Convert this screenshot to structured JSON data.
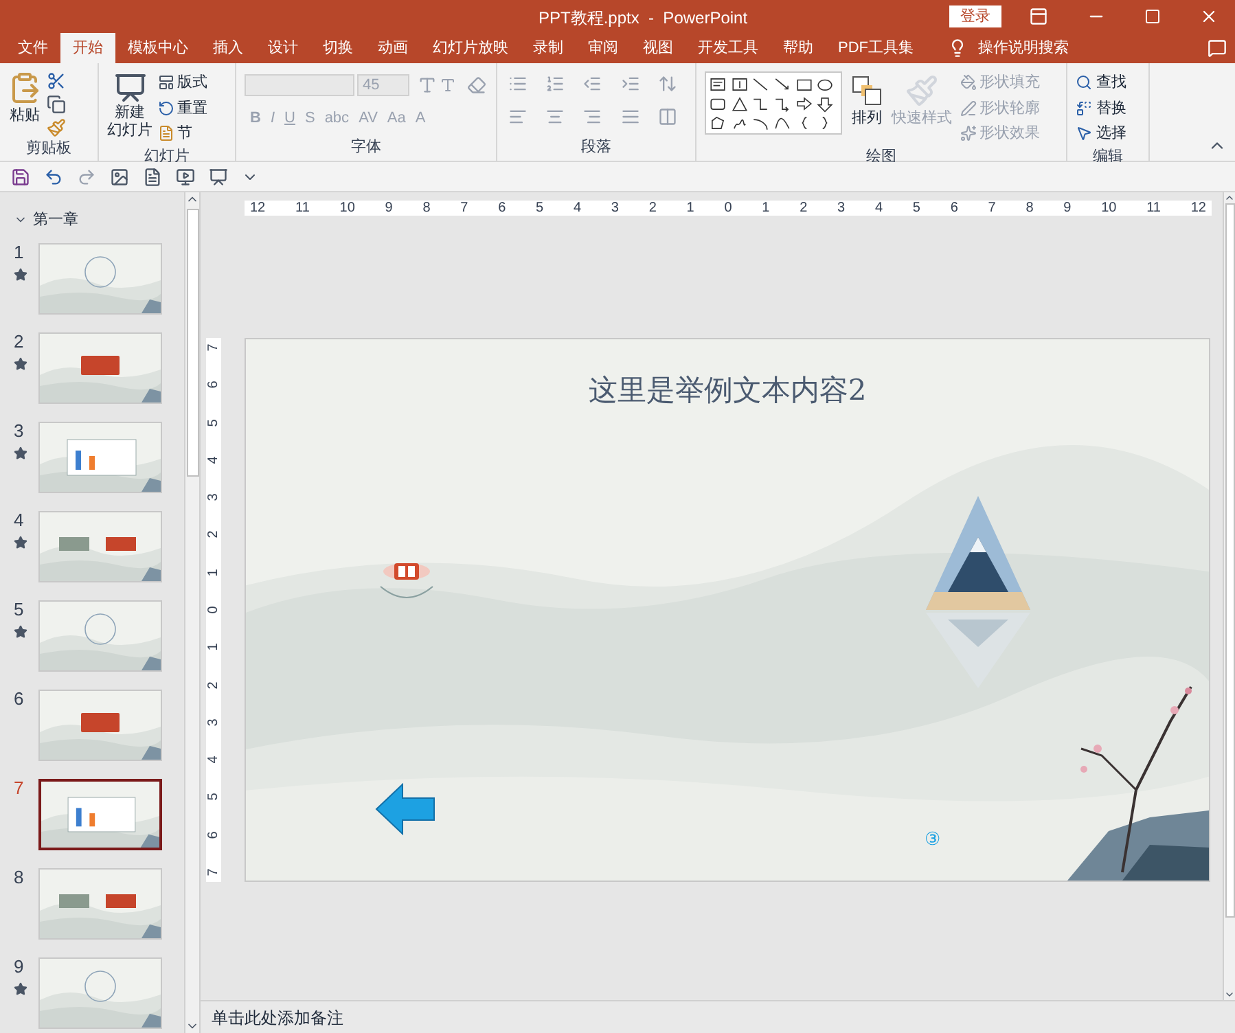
{
  "window": {
    "title": "PPT教程.pptx  -  PowerPoint",
    "sign_in": "登录"
  },
  "tabs": [
    {
      "label": "文件",
      "selected": false
    },
    {
      "label": "开始",
      "selected": true
    },
    {
      "label": "模板中心",
      "selected": false
    },
    {
      "label": "插入",
      "selected": false
    },
    {
      "label": "设计",
      "selected": false
    },
    {
      "label": "切换",
      "selected": false
    },
    {
      "label": "动画",
      "selected": false
    },
    {
      "label": "幻灯片放映",
      "selected": false
    },
    {
      "label": "录制",
      "selected": false
    },
    {
      "label": "审阅",
      "selected": false
    },
    {
      "label": "视图",
      "selected": false
    },
    {
      "label": "开发工具",
      "selected": false
    },
    {
      "label": "帮助",
      "selected": false
    },
    {
      "label": "PDF工具集",
      "selected": false
    }
  ],
  "tell_me": "操作说明搜索",
  "ribbon": {
    "clipboard": {
      "paste": "粘贴",
      "label": "剪贴板"
    },
    "slides": {
      "new_slide": [
        "新建",
        "幻灯片"
      ],
      "layout": "版式",
      "reset": "重置",
      "section": "节",
      "label": "幻灯片"
    },
    "font": {
      "font_size": "45",
      "disabled": true,
      "buttons": [
        "B",
        "I",
        "U",
        "S",
        "abc",
        "AV",
        "Aa",
        "A"
      ],
      "label": "字体"
    },
    "paragraph": {
      "label": "段落"
    },
    "drawing": {
      "arrange": "排列",
      "quick_styles": {
        "label": "快速样式",
        "disabled": true
      },
      "format": [
        {
          "label": "形状填充",
          "disabled": true
        },
        {
          "label": "形状轮廓",
          "disabled": true
        },
        {
          "label": "形状效果",
          "disabled": true
        }
      ],
      "label": "绘图"
    },
    "editing": {
      "items": [
        {
          "label": "查找"
        },
        {
          "label": "替换"
        },
        {
          "label": "选择"
        }
      ],
      "label": "编辑"
    }
  },
  "outline": {
    "section": "第一章",
    "slides": [
      {
        "number": "1",
        "star": true,
        "selected": false
      },
      {
        "number": "2",
        "star": true,
        "selected": false
      },
      {
        "number": "3",
        "star": true,
        "selected": false
      },
      {
        "number": "4",
        "star": true,
        "selected": false
      },
      {
        "number": "5",
        "star": true,
        "selected": false
      },
      {
        "number": "6",
        "star": false,
        "selected": false
      },
      {
        "number": "7",
        "star": false,
        "selected": true
      },
      {
        "number": "8",
        "star": false,
        "selected": false
      },
      {
        "number": "9",
        "star": true,
        "selected": false
      }
    ]
  },
  "ruler": {
    "horizontal": [
      "12",
      "11",
      "10",
      "9",
      "8",
      "7",
      "6",
      "5",
      "4",
      "3",
      "2",
      "1",
      "0",
      "1",
      "2",
      "3",
      "4",
      "5",
      "6",
      "7",
      "8",
      "9",
      "10",
      "11",
      "12"
    ],
    "vertical": [
      "7",
      "6",
      "5",
      "4",
      "3",
      "2",
      "1",
      "0",
      "1",
      "2",
      "3",
      "4",
      "5",
      "6",
      "7"
    ]
  },
  "slide": {
    "title": "这里是举例文本内容2",
    "marker": "③"
  },
  "notes": {
    "placeholder": "单击此处添加备注"
  }
}
